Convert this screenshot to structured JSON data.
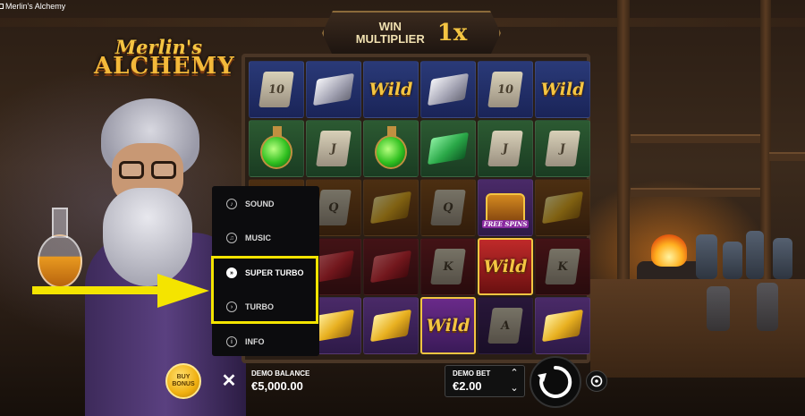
{
  "window": {
    "title": "Merlin's Alchemy"
  },
  "logo": {
    "line1": "Merlin's",
    "line2": "ALCHEMY"
  },
  "win_multiplier": {
    "label_line1": "WIN",
    "label_line2": "MULTIPLIER",
    "value": "1x"
  },
  "reels": {
    "wild_text": "Wild",
    "free_spins_text": "FREE SPINS",
    "scroll_numbers": [
      "10",
      "J",
      "Q",
      "K",
      "A"
    ]
  },
  "menu": {
    "items": [
      {
        "label": "SOUND",
        "icon": "sound-icon"
      },
      {
        "label": "MUSIC",
        "icon": "music-icon"
      },
      {
        "label": "SUPER TURBO",
        "icon": "super-turbo-icon"
      },
      {
        "label": "TURBO",
        "icon": "turbo-icon"
      },
      {
        "label": "INFO",
        "icon": "info-icon"
      }
    ]
  },
  "controls": {
    "buy_bonus_line1": "BUY",
    "buy_bonus_line2": "BONUS",
    "close_label": "✕",
    "balance_label": "DEMO BALANCE",
    "balance_value": "€5,000.00",
    "bet_label": "DEMO BET",
    "bet_value": "€2.00",
    "bet_up": "⌃",
    "bet_down": "⌄"
  },
  "colors": {
    "highlight": "#f4e400",
    "gold": "#f4c542",
    "menu_bg": "#0c0c0e"
  }
}
